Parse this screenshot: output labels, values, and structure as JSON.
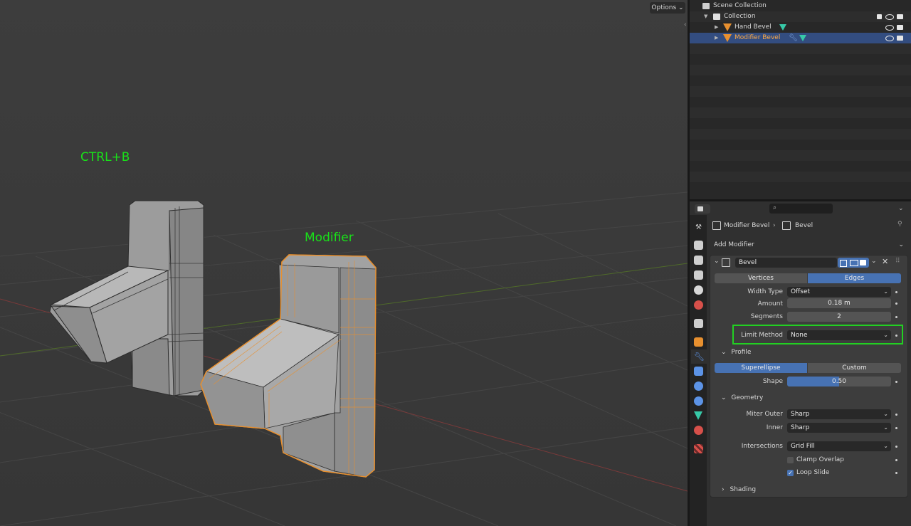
{
  "viewport": {
    "options_label": "Options",
    "labels": {
      "hand": "CTRL+B",
      "modifier": "Modifier"
    }
  },
  "outliner": {
    "rows": [
      {
        "label": "Scene Collection"
      },
      {
        "label": "Collection"
      },
      {
        "label": "Hand Bevel"
      },
      {
        "label": "Modifier Bevel"
      }
    ]
  },
  "properties": {
    "search_placeholder": "",
    "breadcrumb": {
      "object": "Modifier Bevel",
      "modifier": "Bevel"
    },
    "add_modifier": "Add Modifier",
    "modifier": {
      "name": "Bevel",
      "mode": {
        "vertices": "Vertices",
        "edges": "Edges",
        "selected": "Edges"
      },
      "width_type": {
        "label": "Width Type",
        "value": "Offset"
      },
      "amount": {
        "label": "Amount",
        "value": "0.18 m"
      },
      "segments": {
        "label": "Segments",
        "value": "2"
      },
      "limit_method": {
        "label": "Limit Method",
        "value": "None"
      },
      "profile": {
        "title": "Profile",
        "superellipse": "Superellipse",
        "custom": "Custom",
        "shape_label": "Shape",
        "shape_value": "0.50",
        "shape_fraction": 0.5
      },
      "geometry": {
        "title": "Geometry",
        "miter_outer": {
          "label": "Miter Outer",
          "value": "Sharp"
        },
        "inner": {
          "label": "Inner",
          "value": "Sharp"
        },
        "intersections": {
          "label": "Intersections",
          "value": "Grid Fill"
        },
        "clamp_overlap": {
          "label": "Clamp Overlap",
          "checked": false
        },
        "loop_slide": {
          "label": "Loop Slide",
          "checked": true
        }
      },
      "shading": {
        "title": "Shading"
      }
    }
  },
  "colors": {
    "accent": "#4772b3",
    "highlight_box": "#22d022",
    "selection_orange": "#e8902f",
    "viewport_text_green": "#19e019"
  }
}
